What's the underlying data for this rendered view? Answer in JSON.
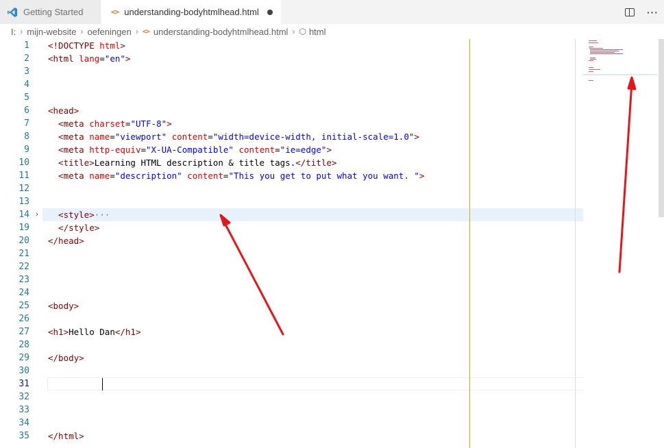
{
  "tabs": [
    {
      "label": "Getting Started",
      "active": false,
      "icon": "vscode-icon"
    },
    {
      "label": "understanding-bodyhtmlhead.html",
      "active": true,
      "icon": "html-file-icon",
      "dirty": true
    }
  ],
  "tab_actions": {
    "split": "split-editor-icon",
    "more": "···"
  },
  "breadcrumb": {
    "items": [
      "I:",
      "mijn-website",
      "oefeningen",
      "understanding-bodyhtmlhead.html",
      "html"
    ],
    "separator": "›"
  },
  "editor": {
    "line_numbers": [
      "1",
      "2",
      "3",
      "4",
      "5",
      "6",
      "7",
      "8",
      "9",
      "10",
      "11",
      "12",
      "13",
      "14",
      "19",
      "20",
      "21",
      "22",
      "23",
      "24",
      "25",
      "26",
      "27",
      "28",
      "29",
      "30",
      "31",
      "32",
      "33",
      "34",
      "35"
    ],
    "current_line": "31",
    "folded_line": "14",
    "lines": {
      "l1_a": "<!DOCTYPE ",
      "l1_b": "html",
      "l1_c": ">",
      "l2_a": "<html ",
      "l2_b": "lang",
      "l2_c": "=",
      "l2_d": "\"en\"",
      "l2_e": ">",
      "l6": "<head>",
      "l7_a": "  <meta ",
      "l7_b": "charset",
      "l7_c": "=",
      "l7_d": "\"UTF-8\"",
      "l7_e": ">",
      "l8_a": "  <meta ",
      "l8_b": "name",
      "l8_c": "=",
      "l8_d": "\"viewport\"",
      "l8_e": " content",
      "l8_f": "=",
      "l8_g": "\"width=device-width, initial-scale=1.0\"",
      "l8_h": ">",
      "l9_a": "  <meta ",
      "l9_b": "http-equiv",
      "l9_c": "=",
      "l9_d": "\"X-UA-Compatible\"",
      "l9_e": " content",
      "l9_f": "=",
      "l9_g": "\"ie=edge\"",
      "l9_h": ">",
      "l10_a": "  <title>",
      "l10_b": "Learning HTML description & title tags.",
      "l10_c": "</title>",
      "l11_a": "  <meta ",
      "l11_b": "name",
      "l11_c": "=",
      "l11_d": "\"description\"",
      "l11_e": " content",
      "l11_f": "=",
      "l11_g": "\"This you get to put what you want. \"",
      "l11_h": ">",
      "l14_a": "  <style>",
      "l14_b": "···",
      "l19": "  </style>",
      "l20": "</head>",
      "l25": "<body>",
      "l27_a": "<h1>",
      "l27_b": "Hello Dan",
      "l27_c": "</h1>",
      "l29": "</body>",
      "l35": "</html>"
    }
  },
  "colors": {
    "tag": "#800000",
    "attribute": "#e50000",
    "string": "#0000ff",
    "text": "#000000",
    "line_number": "#237893",
    "annotation_arrow": "#e8141b"
  }
}
